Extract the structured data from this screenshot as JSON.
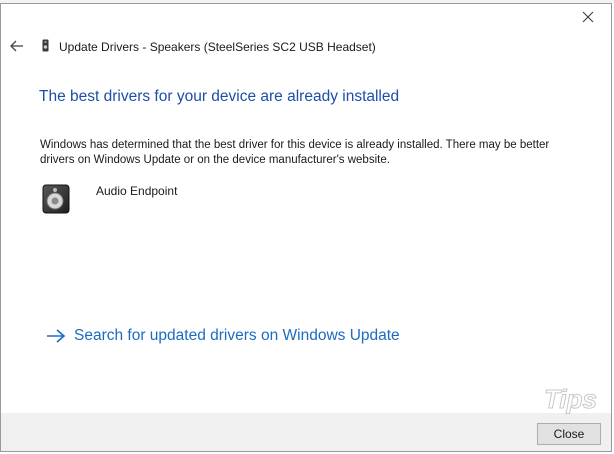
{
  "dialog": {
    "title": "Update Drivers - Speakers (SteelSeries SC2 USB Headset)",
    "heading": "The best drivers for your device are already installed",
    "description": "Windows has determined that the best driver for this device is already installed. There may be better drivers on Windows Update or on the device manufacturer's website.",
    "device_name": "Audio Endpoint",
    "update_link": "Search for updated drivers on Windows Update",
    "close_button": "Close"
  },
  "icons": {
    "back": "back-arrow-icon",
    "close": "close-icon",
    "device": "speaker-device-icon",
    "link_arrow": "arrow-right-icon"
  },
  "colors": {
    "heading": "#1d4ea8",
    "link": "#1d6bbf",
    "footer": "#f0f0f0",
    "button": "#e1e1e1"
  }
}
